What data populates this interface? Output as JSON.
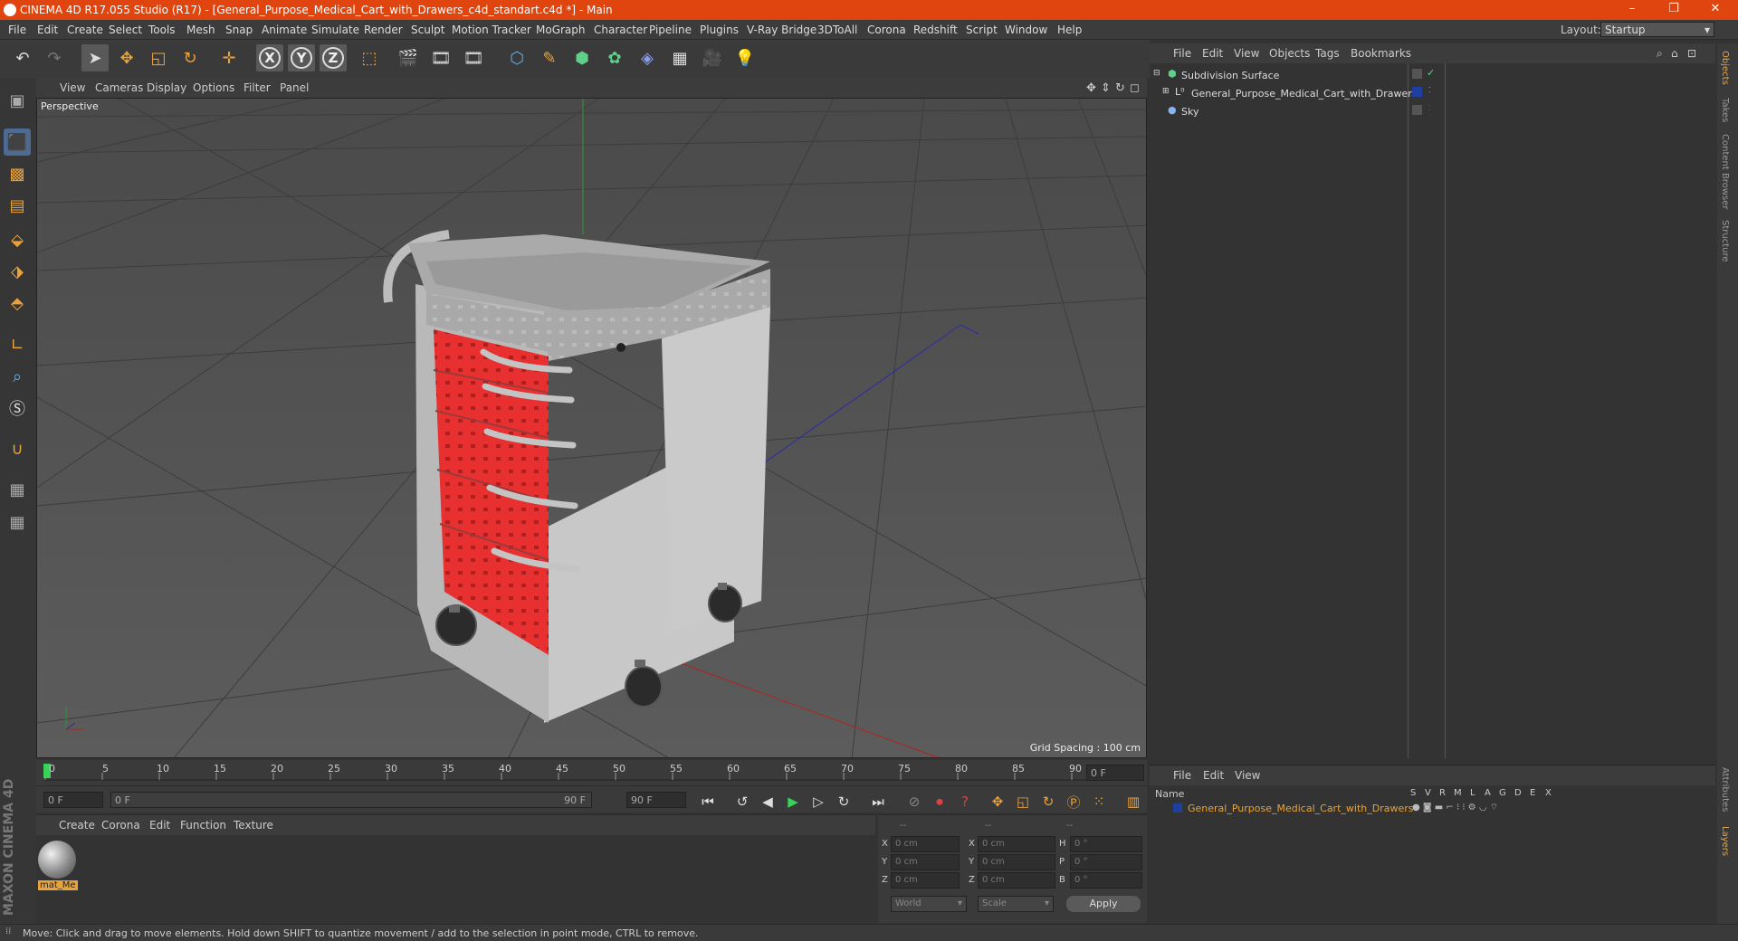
{
  "window": {
    "title": "CINEMA 4D R17.055 Studio (R17) - [General_Purpose_Medical_Cart_with_Drawers_c4d_standart.c4d *] - Main",
    "minimize": "–",
    "maximize": "❐",
    "close": "✕"
  },
  "menu": [
    "File",
    "Edit",
    "Create",
    "Select",
    "Tools",
    "Mesh",
    "Snap",
    "Animate",
    "Simulate",
    "Render",
    "Sculpt",
    "Motion Tracker",
    "MoGraph",
    "Character",
    "Pipeline",
    "Plugins",
    "V-Ray Bridge",
    "3DToAll",
    "Corona",
    "Redshift",
    "Script",
    "Window",
    "Help"
  ],
  "layout": {
    "label": "Layout:",
    "value": "Startup"
  },
  "viewport": {
    "menu": [
      "View",
      "Cameras",
      "Display",
      "Options",
      "Filter",
      "Panel"
    ],
    "camera": "Perspective",
    "grid_spacing": "Grid Spacing : 100 cm"
  },
  "timeline": {
    "ticks": [
      "0",
      "5",
      "10",
      "15",
      "20",
      "25",
      "30",
      "35",
      "40",
      "45",
      "50",
      "55",
      "60",
      "65",
      "70",
      "75",
      "80",
      "85",
      "90"
    ],
    "current_frame": "0 F",
    "start_field": "0 F",
    "range_left": "0 F",
    "range_right": "90 F",
    "end_field": "90 F"
  },
  "material_panel": {
    "menu": [
      "Create",
      "Corona",
      "Edit",
      "Function",
      "Texture"
    ],
    "material_name": "mat_Me"
  },
  "coordinates": {
    "header": [
      "--",
      "--",
      "--"
    ],
    "rows": [
      {
        "a": "X",
        "av": "0 cm",
        "b": "X",
        "bv": "0 cm",
        "c": "H",
        "cv": "0 °"
      },
      {
        "a": "Y",
        "av": "0 cm",
        "b": "Y",
        "bv": "0 cm",
        "c": "P",
        "cv": "0 °"
      },
      {
        "a": "Z",
        "av": "0 cm",
        "b": "Z",
        "bv": "0 cm",
        "c": "B",
        "cv": "0 °"
      }
    ],
    "mode1": "World",
    "mode2": "Scale",
    "apply": "Apply"
  },
  "objects_panel": {
    "menu": [
      "File",
      "Edit",
      "View",
      "Objects",
      "Tags",
      "Bookmarks"
    ],
    "items": [
      {
        "name": "Subdivision Surface",
        "indent": 0
      },
      {
        "name": "General_Purpose_Medical_Cart_with_Drawers",
        "indent": 1
      },
      {
        "name": "Sky",
        "indent": 0
      }
    ]
  },
  "layers_panel": {
    "menu": [
      "File",
      "Edit",
      "View"
    ],
    "name_header": "Name",
    "columns": [
      "S",
      "V",
      "R",
      "M",
      "L",
      "A",
      "G",
      "D",
      "E",
      "X"
    ],
    "layer": "General_Purpose_Medical_Cart_with_Drawers"
  },
  "right_tabs": [
    "Objects",
    "Takes",
    "Content Browser",
    "Structure",
    "Attributes",
    "Layers"
  ],
  "brand": "MAXON CINEMA 4D",
  "status": "Move: Click and drag to move elements. Hold down SHIFT to quantize movement / add to the selection in point mode, CTRL to remove.",
  "colors": {
    "titlebar": "#e0450f",
    "cart_red": "#e83030",
    "layer_orange": "#e8a33b"
  }
}
